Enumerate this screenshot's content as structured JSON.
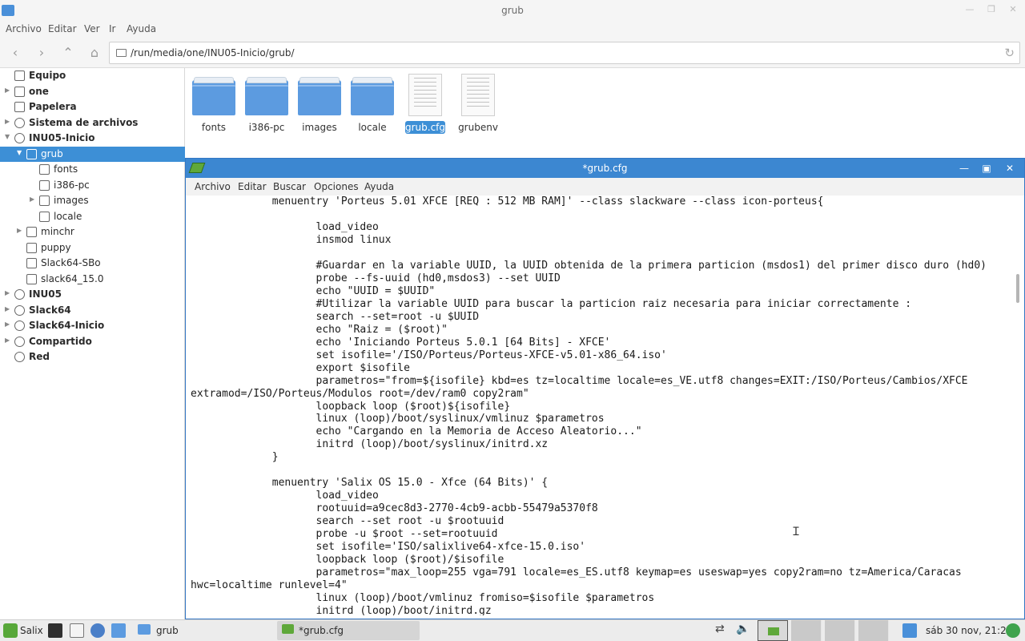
{
  "file_manager": {
    "title": "grub",
    "menu": [
      "Archivo",
      "Editar",
      "Ver",
      "Ir",
      "Ayuda"
    ],
    "path": "/run/media/one/INU05-Inicio/grub/",
    "sidebar": [
      {
        "label": "Equipo",
        "bold": true,
        "depth": 0,
        "expander": "",
        "icon": "computer-icon"
      },
      {
        "label": "one",
        "bold": true,
        "depth": 0,
        "expander": "▶",
        "icon": "home-icon"
      },
      {
        "label": "Papelera",
        "bold": true,
        "depth": 0,
        "expander": "",
        "icon": "trash-icon"
      },
      {
        "label": "Sistema de archivos",
        "bold": true,
        "depth": 0,
        "expander": "▶",
        "icon": "drive-icon"
      },
      {
        "label": "INU05-Inicio",
        "bold": true,
        "depth": 0,
        "expander": "▼",
        "icon": "drive-icon"
      },
      {
        "label": "grub",
        "bold": false,
        "depth": 1,
        "expander": "▼",
        "icon": "folder-icon",
        "selected": true
      },
      {
        "label": "fonts",
        "bold": false,
        "depth": 2,
        "expander": "",
        "icon": "folder-icon"
      },
      {
        "label": "i386-pc",
        "bold": false,
        "depth": 2,
        "expander": "",
        "icon": "folder-icon"
      },
      {
        "label": "images",
        "bold": false,
        "depth": 2,
        "expander": "▶",
        "icon": "folder-icon"
      },
      {
        "label": "locale",
        "bold": false,
        "depth": 2,
        "expander": "",
        "icon": "folder-icon"
      },
      {
        "label": "minchr",
        "bold": false,
        "depth": 1,
        "expander": "▶",
        "icon": "folder-icon"
      },
      {
        "label": "puppy",
        "bold": false,
        "depth": 1,
        "expander": "",
        "icon": "folder-icon"
      },
      {
        "label": "Slack64-SBo",
        "bold": false,
        "depth": 1,
        "expander": "",
        "icon": "folder-icon"
      },
      {
        "label": "slack64_15.0",
        "bold": false,
        "depth": 1,
        "expander": "",
        "icon": "folder-icon"
      },
      {
        "label": "INU05",
        "bold": true,
        "depth": 0,
        "expander": "▶",
        "icon": "drive-icon"
      },
      {
        "label": "Slack64",
        "bold": true,
        "depth": 0,
        "expander": "▶",
        "icon": "drive-icon"
      },
      {
        "label": "Slack64-Inicio",
        "bold": true,
        "depth": 0,
        "expander": "▶",
        "icon": "drive-icon"
      },
      {
        "label": "Compartido",
        "bold": true,
        "depth": 0,
        "expander": "▶",
        "icon": "drive-icon"
      },
      {
        "label": "Red",
        "bold": true,
        "depth": 0,
        "expander": "",
        "icon": "network-icon"
      }
    ],
    "items": [
      {
        "name": "fonts",
        "kind": "folder"
      },
      {
        "name": "i386-pc",
        "kind": "folder"
      },
      {
        "name": "images",
        "kind": "folder"
      },
      {
        "name": "locale",
        "kind": "folder"
      },
      {
        "name": "grub.cfg",
        "kind": "file",
        "selected": true
      },
      {
        "name": "grubenv",
        "kind": "file"
      }
    ]
  },
  "editor": {
    "title": "*grub.cfg",
    "menu": [
      "Archivo",
      "Editar",
      "Buscar",
      "Opciones",
      "Ayuda"
    ],
    "lines": [
      "             menuentry 'Porteus 5.01 XFCE [REQ : 512 MB RAM]' --class slackware --class icon-porteus{",
      "",
      "                    load_video",
      "                    insmod linux",
      "",
      "                    #Guardar en la variable UUID, la UUID obtenida de la primera particion (msdos1) del primer disco duro (hd0)",
      "                    probe --fs-uuid (hd0,msdos3) --set UUID",
      "                    echo \"UUID = $UUID\"",
      "                    #Utilizar la variable UUID para buscar la particion raiz necesaria para iniciar correctamente :",
      "                    search --set=root -u $UUID",
      "                    echo \"Raiz = ($root)\"",
      "                    echo 'Iniciando Porteus 5.0.1 [64 Bits] - XFCE'",
      "                    set isofile='/ISO/Porteus/Porteus-XFCE-v5.01-x86_64.iso'",
      "                    export $isofile",
      "                    parametros=\"from=${isofile} kbd=es tz=localtime locale=es_VE.utf8 changes=EXIT:/ISO/Porteus/Cambios/XFCE",
      "extramod=/ISO/Porteus/Modulos root=/dev/ram0 copy2ram\"",
      "                    loopback loop ($root)${isofile}",
      "                    linux (loop)/boot/syslinux/vmlinuz $parametros",
      "                    echo \"Cargando en la Memoria de Acceso Aleatorio...\"",
      "                    initrd (loop)/boot/syslinux/initrd.xz",
      "             }",
      "",
      "             menuentry 'Salix OS 15.0 - Xfce (64 Bits)' {",
      "                    load_video",
      "                    rootuuid=a9cec8d3-2770-4cb9-acbb-55479a5370f8",
      "                    search --set root -u $rootuuid",
      "                    probe -u $root --set=rootuuid",
      "                    set isofile='ISO/salixlive64-xfce-15.0.iso'",
      "                    loopback loop ($root)/$isofile",
      "                    parametros=\"max_loop=255 vga=791 locale=es_ES.utf8 keymap=es useswap=yes copy2ram=no tz=America/Caracas",
      "hwc=localtime runlevel=4\"",
      "                    linux (loop)/boot/vmlinuz fromiso=$isofile $parametros",
      "                    initrd (loop)/boot/initrd.gz"
    ]
  },
  "taskbar": {
    "start_label": "Salix",
    "tasks": [
      {
        "label": "grub",
        "active": false
      },
      {
        "label": "*grub.cfg",
        "active": true
      }
    ],
    "clock": "sáb 30 nov, 21:20"
  },
  "colors": {
    "selection": "#3d8fd6",
    "editor_titlebar": "#3c87d1",
    "folder": "#5c9be0"
  }
}
